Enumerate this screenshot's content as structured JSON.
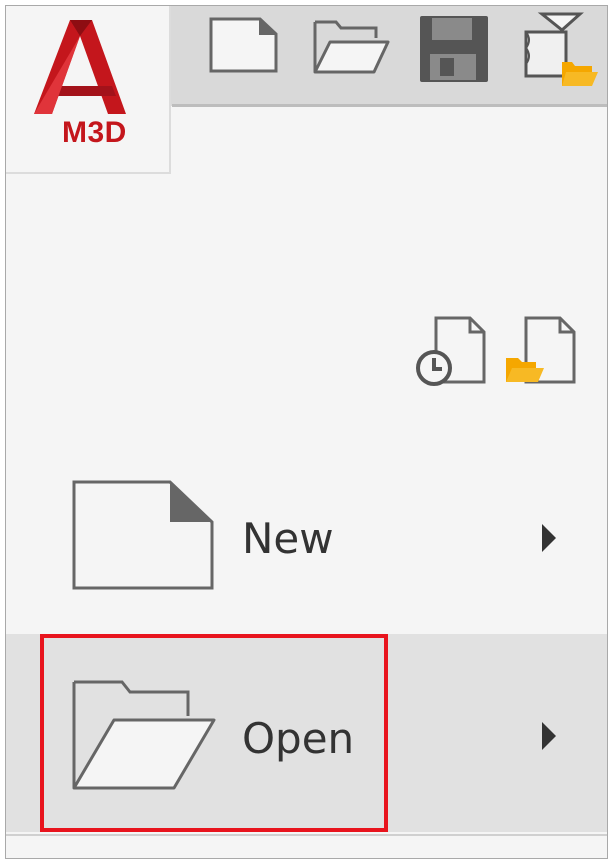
{
  "app": {
    "badge": "M3D",
    "logo_icon": "autocad-a-logo",
    "brand_color": "#c4161c"
  },
  "quick_access": [
    {
      "name": "new",
      "icon": "new-document-icon"
    },
    {
      "name": "open",
      "icon": "open-folder-icon"
    },
    {
      "name": "save",
      "icon": "save-icon"
    },
    {
      "name": "open-from-web",
      "icon": "open-from-web-icon"
    }
  ],
  "recent_icons": [
    {
      "name": "recent-documents",
      "icon": "recent-documents-icon"
    },
    {
      "name": "open-documents",
      "icon": "open-documents-icon"
    }
  ],
  "menu": {
    "new_label": "New",
    "open_label": "Open",
    "hovered": "Open"
  },
  "colors": {
    "folder_accent": "#f5a700",
    "highlight": "#e8141d"
  }
}
